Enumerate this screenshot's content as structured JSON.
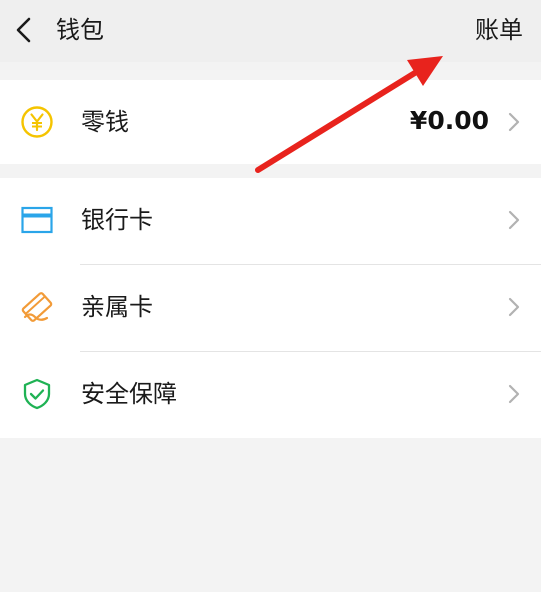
{
  "header": {
    "title": "钱包",
    "right_action": "账单",
    "back_icon": "chevron-left-icon"
  },
  "balance": {
    "label": "零钱",
    "value": "¥0.00",
    "icon": "yen-coin-icon",
    "icon_color": "#f5c400"
  },
  "items": [
    {
      "label": "银行卡",
      "icon": "bank-card-icon",
      "icon_color": "#2aa5e9"
    },
    {
      "label": "亲属卡",
      "icon": "family-card-icon",
      "icon_color": "#f29b38"
    },
    {
      "label": "安全保障",
      "icon": "shield-check-icon",
      "icon_color": "#1fb254"
    }
  ],
  "annotation": {
    "arrow_color": "#e8231d"
  },
  "colors": {
    "background": "#f3f3f3",
    "card": "#ffffff",
    "chevron": "#b2b2b2"
  }
}
